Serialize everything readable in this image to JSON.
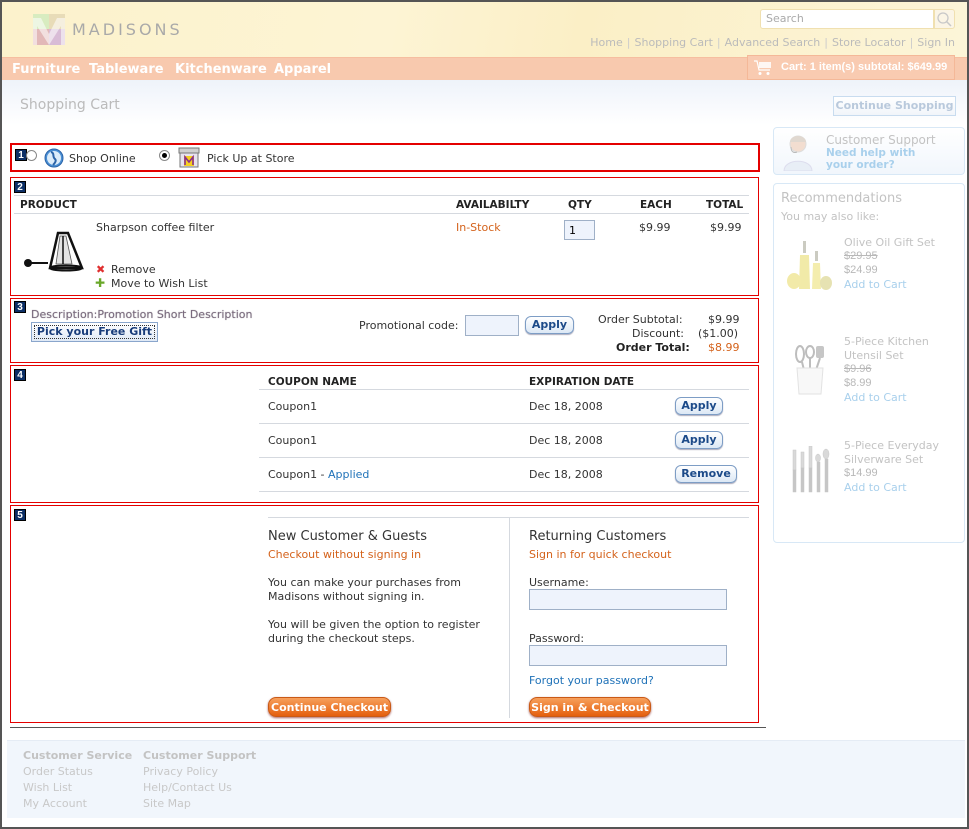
{
  "header": {
    "logo_text": "MADISONS",
    "search_placeholder": "Search",
    "top_links": [
      "Home",
      "Shopping Cart",
      "Advanced Search",
      "Store Locator",
      "Sign In"
    ],
    "nav": [
      "Furniture",
      "Tableware",
      "Kitchenware",
      "Apparel"
    ],
    "cart_summary": "Cart: 1 item(s) subtotal: $649.99"
  },
  "page": {
    "title": "Shopping Cart",
    "continue_shopping": "Continue Shopping"
  },
  "section_badges": [
    "1",
    "2",
    "3",
    "4",
    "5"
  ],
  "shipping_mode": {
    "options": [
      {
        "label": "Shop Online",
        "icon": "globe-icon",
        "selected": false
      },
      {
        "label": "Pick Up at Store",
        "icon": "store-icon",
        "selected": true
      }
    ]
  },
  "cart_table": {
    "headers": {
      "product": "PRODUCT",
      "availability": "AVAILABILTY",
      "qty": "QTY",
      "each": "EACH",
      "total": "TOTAL"
    },
    "items": [
      {
        "name": "Sharpson coffee filter",
        "availability": "In-Stock",
        "qty": "1",
        "each": "$9.99",
        "total": "$9.99",
        "remove_label": "Remove",
        "wishlist_label": "Move to Wish List"
      }
    ]
  },
  "promotion": {
    "description": "Description:Promotion Short Description",
    "gift_button": "Pick your Free Gift",
    "code_label": "Promotional code:",
    "code_value": "",
    "apply_label": "Apply",
    "subtotal_label": "Order Subtotal:",
    "subtotal_value": "$9.99",
    "discount_label": "Discount:",
    "discount_value": "($1.00)",
    "total_label": "Order Total:",
    "total_value": "$8.99"
  },
  "coupons": {
    "headers": {
      "name": "COUPON NAME",
      "expiration": "EXPIRATION DATE"
    },
    "rows": [
      {
        "name": "Coupon1",
        "status": "",
        "expiration": "Dec 18, 2008",
        "action": "Apply"
      },
      {
        "name": "Coupon1",
        "status": "",
        "expiration": "Dec 18, 2008",
        "action": "Apply"
      },
      {
        "name": "Coupon1 - ",
        "status": "Applied",
        "expiration": "Dec 18, 2008",
        "action": "Remove"
      }
    ]
  },
  "checkout": {
    "new_customer": {
      "title": "New Customer & Guests",
      "subtitle": "Checkout without signing in",
      "para1_line1": "You can make your purchases from",
      "para1_line2": "Madisons without signing in.",
      "para2_line1": "You will be given the option to register",
      "para2_line2": "during the checkout steps.",
      "button": "Continue Checkout"
    },
    "returning": {
      "title": "Returning Customers",
      "subtitle": "Sign in for quick checkout",
      "username_label": "Username:",
      "username_value": "",
      "password_label": "Password:",
      "password_value": "",
      "forgot_link": "Forgot your password?",
      "button": "Sign in & Checkout"
    }
  },
  "sidebar": {
    "support": {
      "title": "Customer Support",
      "link_line1": "Need help with",
      "link_line2": "your order?"
    },
    "recommendations": {
      "title": "Recommendations",
      "subtitle": "You may also like:",
      "items": [
        {
          "name_line1": "Olive Oil Gift Set",
          "name_line2": "",
          "old_price": "$29.95",
          "price": "$24.99",
          "cta": "Add to Cart"
        },
        {
          "name_line1": "5-Piece Kitchen",
          "name_line2": "Utensil Set",
          "old_price": "$9.96",
          "price": "$8.99",
          "cta": "Add to Cart"
        },
        {
          "name_line1": "5-Piece Everyday",
          "name_line2": "Silverware Set",
          "old_price": "",
          "price": "$14.99",
          "cta": "Add to Cart"
        }
      ]
    }
  },
  "footer": {
    "col1": {
      "title": "Customer Service",
      "links": [
        "Order Status",
        "Wish List",
        "My Account"
      ]
    },
    "col2": {
      "title": "Customer Support",
      "links": [
        "Privacy Policy",
        "Help/Contact Us",
        "Site Map"
      ]
    }
  }
}
